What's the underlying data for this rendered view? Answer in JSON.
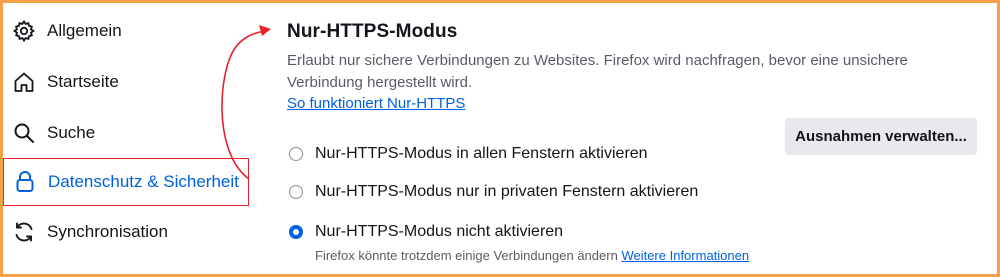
{
  "sidebar": {
    "items": [
      {
        "label": "Allgemein",
        "icon": "gear-icon"
      },
      {
        "label": "Startseite",
        "icon": "home-icon"
      },
      {
        "label": "Suche",
        "icon": "search-icon"
      },
      {
        "label": "Datenschutz & Sicherheit",
        "icon": "lock-icon",
        "selected": true
      },
      {
        "label": "Synchronisation",
        "icon": "sync-icon"
      }
    ]
  },
  "https_only": {
    "title": "Nur-HTTPS-Modus",
    "description": "Erlaubt nur sichere Verbindungen zu Websites. Firefox wird nachfragen, bevor eine unsichere Verbindung hergestellt wird.",
    "learn_link": "So funktioniert Nur-HTTPS",
    "exceptions_button": "Ausnahmen verwalten...",
    "options": [
      {
        "label": "Nur-HTTPS-Modus in allen Fenstern aktivieren",
        "checked": false
      },
      {
        "label": "Nur-HTTPS-Modus nur in privaten Fenstern aktivieren",
        "checked": false
      },
      {
        "label": "Nur-HTTPS-Modus nicht aktivieren",
        "checked": true
      }
    ],
    "note": "Firefox könnte trotzdem einige Verbindungen ändern",
    "note_link": "Weitere Informationen"
  },
  "colors": {
    "accent": "#0061e0",
    "highlight_border": "#e8232b",
    "page_border": "#f5a04a",
    "button_bg": "#e9e9ed"
  }
}
